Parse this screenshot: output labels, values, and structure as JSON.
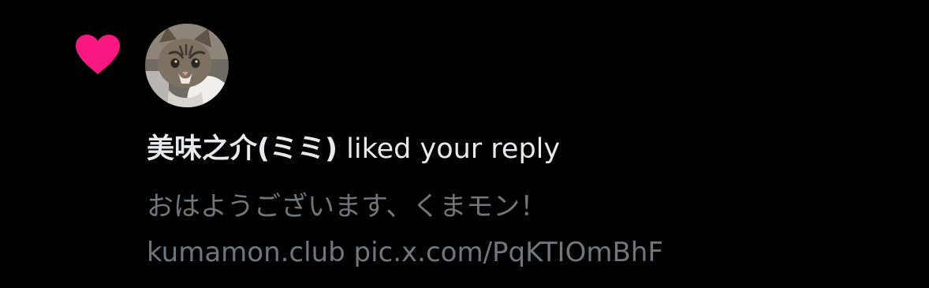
{
  "colors": {
    "background": "#000000",
    "heart": "#f91880",
    "primary_text": "#e7e9ea",
    "secondary_text": "#71767b"
  },
  "notification": {
    "icon": "heart-icon",
    "avatar_icon": "cat-avatar",
    "user_name": "美味之介(ミミ)",
    "action": "liked your reply",
    "reply_text_line1": "おはようございます、くまモン！",
    "reply_text_line2": "kumamon.club pic.x.com/PqKTIOmBhF"
  }
}
